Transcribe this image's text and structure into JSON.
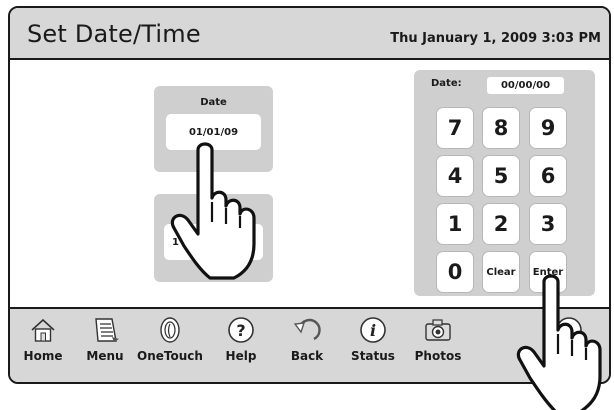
{
  "header": {
    "title": "Set Date/Time",
    "datetime": "Thu January 1, 2009  3:03 PM"
  },
  "date_card": {
    "label": "Date",
    "value": "01/01/09"
  },
  "time_card": {
    "value": "1"
  },
  "keypad": {
    "label": "Date:",
    "value": "00/00/00",
    "keys": [
      "7",
      "8",
      "9",
      "4",
      "5",
      "6",
      "1",
      "2",
      "3",
      "0",
      "Clear",
      "Enter"
    ]
  },
  "nav": {
    "items": [
      {
        "label": "Home",
        "icon": "home-icon"
      },
      {
        "label": "Menu",
        "icon": "menu-icon"
      },
      {
        "label": "OneTouch",
        "icon": "onetouch-icon"
      },
      {
        "label": "Help",
        "icon": "help-icon"
      },
      {
        "label": "Back",
        "icon": "back-icon"
      },
      {
        "label": "Status",
        "icon": "status-icon"
      },
      {
        "label": "Photos",
        "icon": "photos-icon"
      }
    ]
  }
}
